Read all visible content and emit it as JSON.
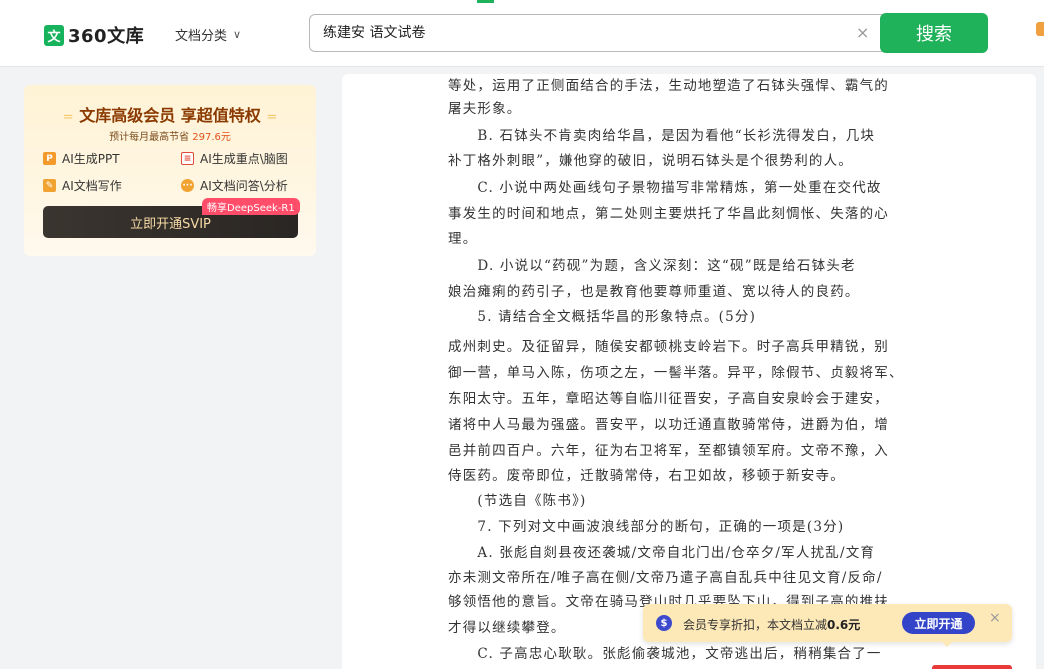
{
  "header": {
    "logo_mark": "文",
    "logo_text": "360文库",
    "category_menu": "文档分类",
    "search_value": "练建安 语文试卷",
    "search_button": "搜索"
  },
  "vip": {
    "deco_left": "=",
    "title": "文库高级会员 享超值特权",
    "deco_right": "=",
    "subtitle_prefix": "预计每月最高节省",
    "subtitle_price": "297.6元",
    "features": [
      "AI生成PPT",
      "AI生成重点\\脑图",
      "AI文档写作",
      "AI文档问答\\分析"
    ],
    "feature_icons": [
      "P",
      "≡",
      "✎",
      "···"
    ],
    "button": "立即开通SVIP",
    "badge": "畅享DeepSeek-R1"
  },
  "document": {
    "lines": [
      "等处，运用了正侧面结合的手法，生动地塑造了石钵头强悍、霸气的",
      "屠夫形象。",
      "　　B. 石钵头不肯卖肉给华昌，是因为看他“长衫洗得发白，几块",
      "补丁格外刺眼”，嫌他穿的破旧，说明石钵头是个很势利的人。",
      "　　C. 小说中两处画线句子景物描写非常精炼，第一处重在交代故",
      "事发生的时间和地点，第二处则主要烘托了华昌此刻惆怅、失落的心",
      "理。",
      "　　D. 小说以“药砚”为题，含义深刻：这“砚”既是给石钵头老",
      "娘治瘫痢的药引子，也是教育他要尊师重道、宽以待人的良药。",
      "　　5. 请结合全文概括华昌的形象特点。(5分)",
      "成州刺史。及征留异，随侯安都顿桃支岭岩下。时子高兵甲精锐，别",
      "御一营，单马入陈，伤项之左，一髻半落。异平，除假节、贞毅将军、",
      "东阳太守。五年，章昭达等自临川征晋安，子高自安泉岭会于建安，",
      "诸将中人马最为强盛。晋安平，以功迁通直散骑常侍，进爵为伯，增",
      "邑并前四百户。六年，征为右卫将军，至都镇领军府。文帝不豫，入",
      "侍医药。废帝即位，迁散骑常侍，右卫如故，移顿于新安寺。",
      "　　(节选自《陈书》)",
      "　　7. 下列对文中画波浪线部分的断句，正确的一项是(3分)",
      "　　A. 张彪自剡县夜还袭城/文帝自北门出/仓卒夕/军人扰乱/文育",
      "亦未测文帝所在/唯子高在侧/文帝乃遣子高自乱兵中往见文育/反命/",
      "够领悟他的意旨。文帝在骑马登山时几乎要坠下山，得到子高的推扶",
      "才得以继续攀登。",
      "　　C. 子高忠心耿耿。张彪偷袭城池，文帝逃出后，稍稍集合了一"
    ]
  },
  "promo": {
    "icon": "$",
    "text_prefix": "会员专享折扣，本文档立减",
    "amount": "0.6元",
    "button": "立即开通",
    "close": "×"
  },
  "icons": {
    "clear": "×",
    "chevron": "∨"
  }
}
